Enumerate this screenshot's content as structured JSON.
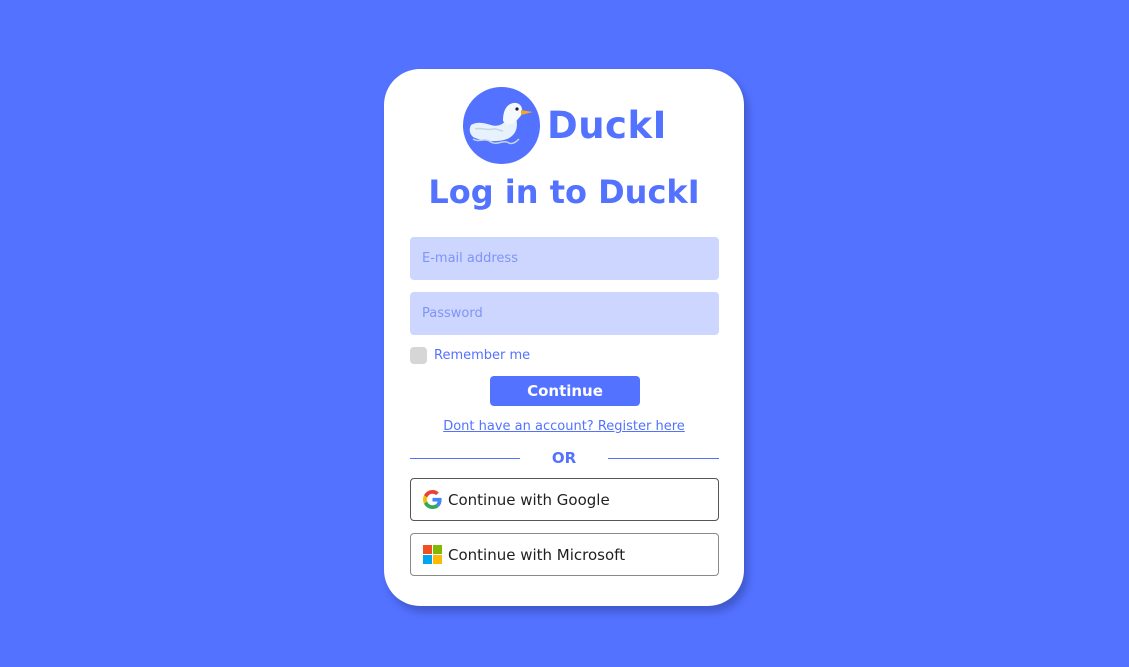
{
  "brand": {
    "name": "DuckI",
    "logo_icon": "duck-icon",
    "accent_color": "#5372FF"
  },
  "login": {
    "title": "Log in to DuckI",
    "email_placeholder": "E-mail address",
    "password_placeholder": "Password",
    "remember_label": "Remember me",
    "remember_checked": false,
    "continue_label": "Continue",
    "register_link": "Dont have an account? Register here",
    "divider_text": "OR"
  },
  "oauth": {
    "google": {
      "label": "Continue with Google",
      "icon": "google-icon"
    },
    "microsoft": {
      "label": "Continue with Microsoft",
      "icon": "microsoft-icon"
    }
  }
}
